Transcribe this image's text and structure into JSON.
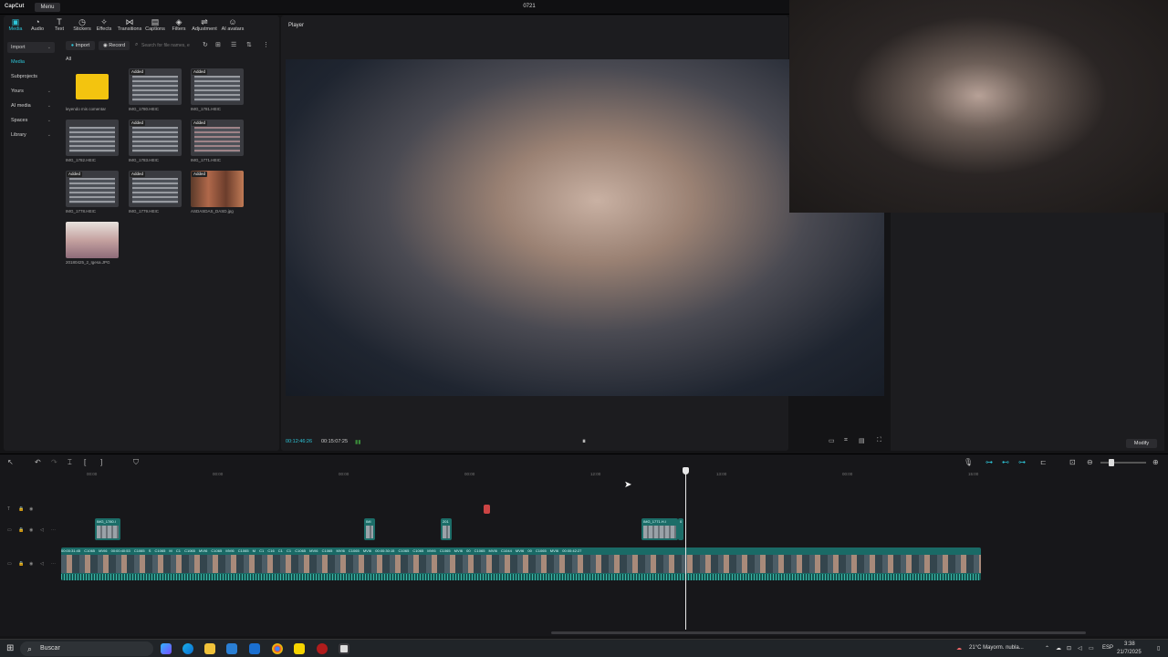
{
  "app": {
    "logo": "CapCut",
    "menu": "Menu",
    "project_title": "0721"
  },
  "top_tabs": [
    {
      "label": "Media",
      "icon": "media-icon",
      "active": true
    },
    {
      "label": "Audio",
      "icon": "audio-icon"
    },
    {
      "label": "Text",
      "icon": "text-icon"
    },
    {
      "label": "Stickers",
      "icon": "stickers-icon"
    },
    {
      "label": "Effects",
      "icon": "effects-icon"
    },
    {
      "label": "Transitions",
      "icon": "transitions-icon"
    },
    {
      "label": "Captions",
      "icon": "captions-icon"
    },
    {
      "label": "Filters",
      "icon": "filters-icon"
    },
    {
      "label": "Adjustment",
      "icon": "adjustment-icon"
    },
    {
      "label": "AI avatars",
      "icon": "ai-avatars-icon"
    }
  ],
  "sidebar": {
    "items": [
      "Import",
      "Media",
      "Subprojects",
      "Yours",
      "AI media",
      "Spaces",
      "Library"
    ]
  },
  "media_toolbar": {
    "import": "Import",
    "record": "Record",
    "search_placeholder": "Search for file names, e",
    "all": "All"
  },
  "media": {
    "added_badge": "Added",
    "items": [
      {
        "name": "leyendo mis comentar",
        "type": "folder"
      },
      {
        "name": "IMG_1780.HEIC",
        "added": true
      },
      {
        "name": "IMG_1781.HEIC",
        "added": true
      },
      {
        "name": "IMG_1782.HEIC",
        "added": false
      },
      {
        "name": "IMG_1783.HEIC",
        "added": true
      },
      {
        "name": "IMG_1771.HEIC",
        "added": true
      },
      {
        "name": "IMG_1778.HEIC",
        "added": true
      },
      {
        "name": "IMG_1779.HEIC",
        "added": true
      },
      {
        "name": "ASDASDAS_DASD.jpg",
        "added": true
      },
      {
        "name": "20180425_2_Igesa.JPG",
        "added": false
      }
    ]
  },
  "player": {
    "label": "Player",
    "current_time": "00:12:46:26",
    "total_time": "00:15:07:25",
    "modify": "Modify"
  },
  "timeline": {
    "ruler": [
      "00:00",
      "00:00",
      "00:00",
      "00:00",
      "12:00",
      "13:00",
      "00:00",
      "15:00"
    ],
    "overlay_clips": [
      "IMG_1780.I",
      "IMI",
      "201",
      "IMG_1771.H.I",
      "0"
    ],
    "main_track_labels": "00:00:31:45 C1065 MVI6 00:00:40:53 C1065 S C1065 M C1 C1065 MVI6 C1065 MVI6 C1065 M C1 C16 C1 C1 C1065 MVI6 C1065 MVI6 C1065 MVI6 00:00:30:15 C1065 C1065 MVI6 C1065 MVI6 00 C1065 MVI6 C1044 MVI6 00 C1065 MVI6 00:00:42:27"
  },
  "taskbar": {
    "search": "Buscar",
    "weather": "21°C  Mayorm. nubla...",
    "lang": "ESP",
    "time": "3:38",
    "date": "21/7/2025"
  }
}
